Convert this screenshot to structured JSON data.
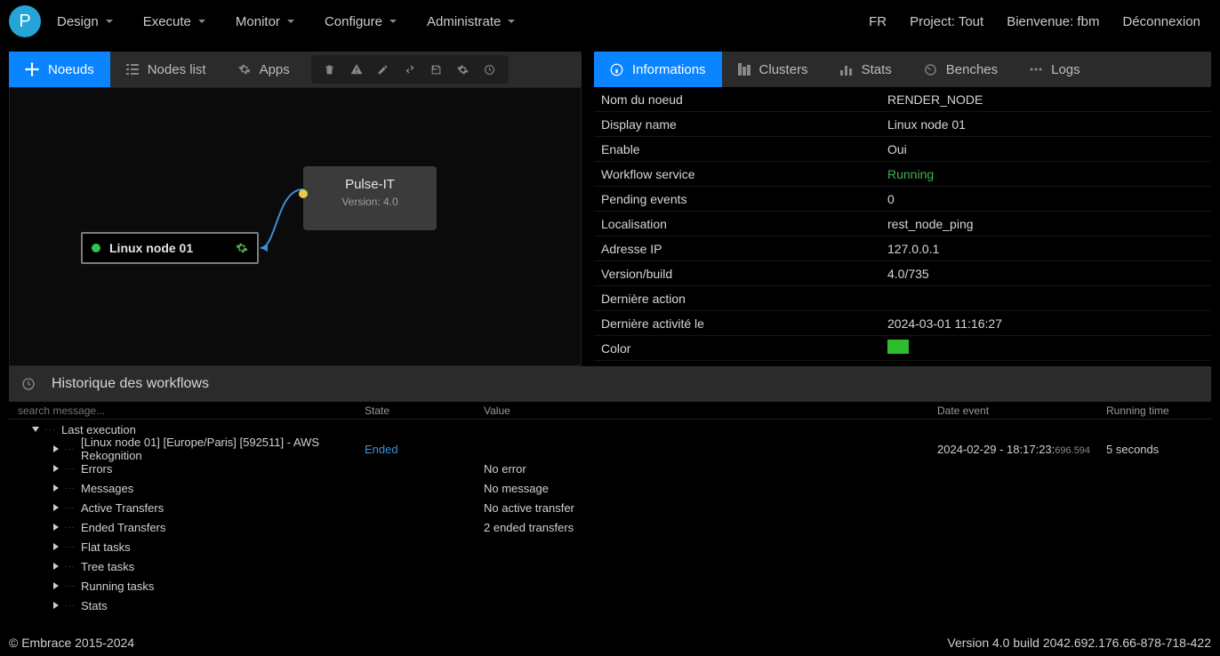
{
  "logo": "P",
  "nav": {
    "items": [
      "Design",
      "Execute",
      "Monitor",
      "Configure",
      "Administrate"
    ],
    "right": {
      "lang": "FR",
      "project": "Project: Tout",
      "welcome": "Bienvenue: fbm",
      "logout": "Déconnexion"
    }
  },
  "left_tabs": {
    "noeuds": "Noeuds",
    "nodes_list": "Nodes list",
    "apps": "Apps"
  },
  "canvas": {
    "central_title": "Pulse-IT",
    "central_sub": "Version: 4.0",
    "node_label": "Linux node 01"
  },
  "right_tabs": {
    "informations": "Informations",
    "clusters": "Clusters",
    "stats": "Stats",
    "benches": "Benches",
    "logs": "Logs"
  },
  "info": {
    "rows": [
      {
        "k": "Nom du noeud",
        "v": "RENDER_NODE"
      },
      {
        "k": "Display name",
        "v": "Linux node 01"
      },
      {
        "k": "Enable",
        "v": "Oui"
      },
      {
        "k": "Workflow service",
        "v": "Running",
        "green": true
      },
      {
        "k": "Pending events",
        "v": "0"
      },
      {
        "k": "Localisation",
        "v": "rest_node_ping"
      },
      {
        "k": "Adresse IP",
        "v": "127.0.0.1"
      },
      {
        "k": "Version/build",
        "v": "4.0/735"
      },
      {
        "k": "Dernière action",
        "v": ""
      },
      {
        "k": "Dernière activité le",
        "v": "2024-03-01 11:16:27"
      },
      {
        "k": "Color",
        "v": "",
        "swatch": "#2dbd2d"
      }
    ]
  },
  "history": {
    "title": "Historique des workflows",
    "search_placeholder": "search message...",
    "cols": {
      "state": "State",
      "value": "Value",
      "date": "Date event",
      "run": "Running time"
    },
    "root": {
      "label": "Last execution"
    },
    "exec": {
      "label": "[Linux node 01] [Europe/Paris] [592511] - AWS Rekognition",
      "state": "Ended",
      "date_main": "2024-02-29  -  18:17:23:",
      "date_ms": "696.594",
      "runtime": "5 seconds"
    },
    "children": [
      {
        "label": "Errors",
        "value": "No error"
      },
      {
        "label": "Messages",
        "value": "No message"
      },
      {
        "label": "Active Transfers",
        "value": "No active transfer"
      },
      {
        "label": "Ended Transfers",
        "value": "2 ended transfers"
      },
      {
        "label": "Flat tasks",
        "value": ""
      },
      {
        "label": "Tree tasks",
        "value": ""
      },
      {
        "label": "Running tasks",
        "value": ""
      },
      {
        "label": "Stats",
        "value": ""
      }
    ]
  },
  "footer": {
    "left": "© Embrace 2015-2024",
    "right": "Version 4.0 build 2042.692.176.66-878-718-422"
  }
}
